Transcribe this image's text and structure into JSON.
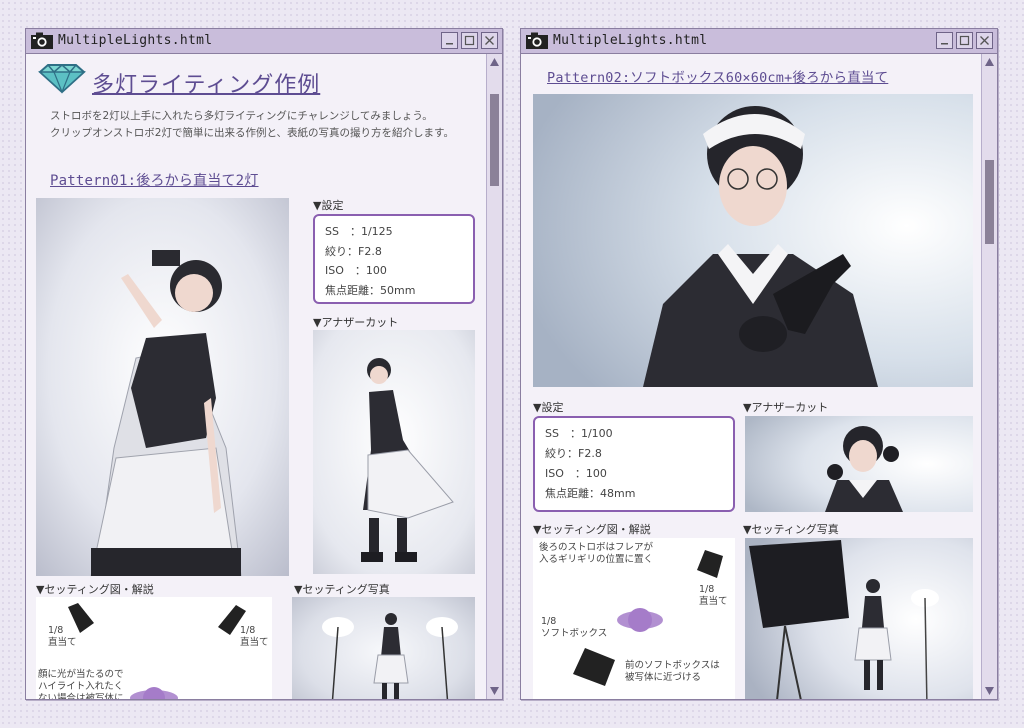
{
  "left_window": {
    "title": "MultipleLights.html",
    "heading": "多灯ライティング作例",
    "intro_line1": "ストロボを2灯以上手に入れたら多灯ライティングにチャレンジしてみましょう。",
    "intro_line2": "クリップオンストロボ2灯で簡単に出来る作例と、表紙の写真の撮り方を紹介します。",
    "pattern_title": "Pattern01:後ろから直当て2灯",
    "settings_label": "▼設定",
    "settings": {
      "ss": "SS　：1/125",
      "aperture": "絞り：F2.8",
      "iso": "ISO　：100",
      "focal": "焦点距離：50mm"
    },
    "another_cut_label": "▼アナザーカット",
    "diagram_label": "▼セッティング図・解説",
    "setup_photo_label": "▼セッティング写真",
    "diagram": {
      "left_light": "1/8\n直当て",
      "right_light": "1/8\n直当て",
      "note": "顔に光が当たるので\nハイライト入れたく\nない場合は被写体に\n前を向いてもらう"
    }
  },
  "right_window": {
    "title": "MultipleLights.html",
    "pattern_title": "Pattern02:ソフトボックス60×60cm+後ろから直当て",
    "settings_label": "▼設定",
    "settings": {
      "ss": "SS　：1/100",
      "aperture": "絞り：F2.8",
      "iso": "ISO　：100",
      "focal": "焦点距離：48mm"
    },
    "another_cut_label": "▼アナザーカット",
    "diagram_label": "▼セッティング図・解説",
    "setup_photo_label": "▼セッティング写真",
    "diagram": {
      "back_note": "後ろのストロボはフレアが\n入るギリギリの位置に置く",
      "back_light": "1/8\n直当て",
      "softbox_light": "1/8\nソフトボックス",
      "front_note": "前のソフトボックスは\n被写体に近づける"
    }
  },
  "colors": {
    "accent": "#5e4d92",
    "frame": "#8a5fb0",
    "titlebar": "#c9bddb",
    "subject": "#a57cc9"
  }
}
